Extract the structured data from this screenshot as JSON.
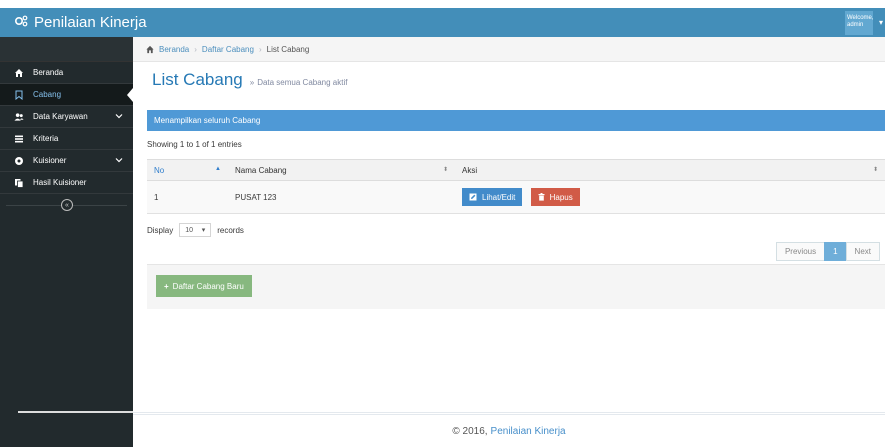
{
  "navbar": {
    "brand": "Penilaian Kinerja",
    "user_greeting": "Welcome,",
    "user_name": "admin"
  },
  "sidebar": {
    "items": [
      {
        "label": "Beranda",
        "icon": "home-icon",
        "active": false,
        "has_submenu": false
      },
      {
        "label": "Cabang",
        "icon": "bookmark-icon",
        "active": true,
        "has_submenu": false
      },
      {
        "label": "Data Karyawan",
        "icon": "users-icon",
        "active": false,
        "has_submenu": true
      },
      {
        "label": "Kriteria",
        "icon": "list-icon",
        "active": false,
        "has_submenu": false
      },
      {
        "label": "Kuisioner",
        "icon": "circle-icon",
        "active": false,
        "has_submenu": true
      },
      {
        "label": "Hasil Kuisioner",
        "icon": "copy-icon",
        "active": false,
        "has_submenu": false
      }
    ],
    "collapse_icon": "double-angle-left-icon"
  },
  "breadcrumbs": {
    "items": [
      "Beranda",
      "Daftar Cabang",
      "List Cabang"
    ],
    "separator": "›"
  },
  "page_header": {
    "title": "List Cabang",
    "chevron": "»",
    "subtitle": "Data semua Cabang aktif"
  },
  "table": {
    "header_bar": "Menampilkan seluruh Cabang",
    "info": "Showing 1 to 1 of 1 entries",
    "columns": [
      "No",
      "Nama Cabang",
      "Aksi"
    ],
    "rows": [
      {
        "no": "1",
        "nama": "PUSAT 123"
      }
    ],
    "actions": {
      "edit_label": "Lihat/Edit",
      "delete_label": "Hapus"
    }
  },
  "length_menu": {
    "prefix": "Display",
    "value": "10",
    "suffix": "records"
  },
  "pagination": {
    "previous": "Previous",
    "current": "1",
    "next": "Next"
  },
  "form_actions": {
    "add_label": "Daftar Cabang Baru"
  },
  "footer": {
    "copyright": "© 2016,",
    "brand": "Penilaian Kinerja"
  },
  "colors": {
    "navbar": "#438eb9",
    "sidebar": "#222a2d",
    "table_header": "#4f99d6",
    "edit_button": "#428bca",
    "delete_button": "#d15b47",
    "add_button": "#87b87f"
  }
}
